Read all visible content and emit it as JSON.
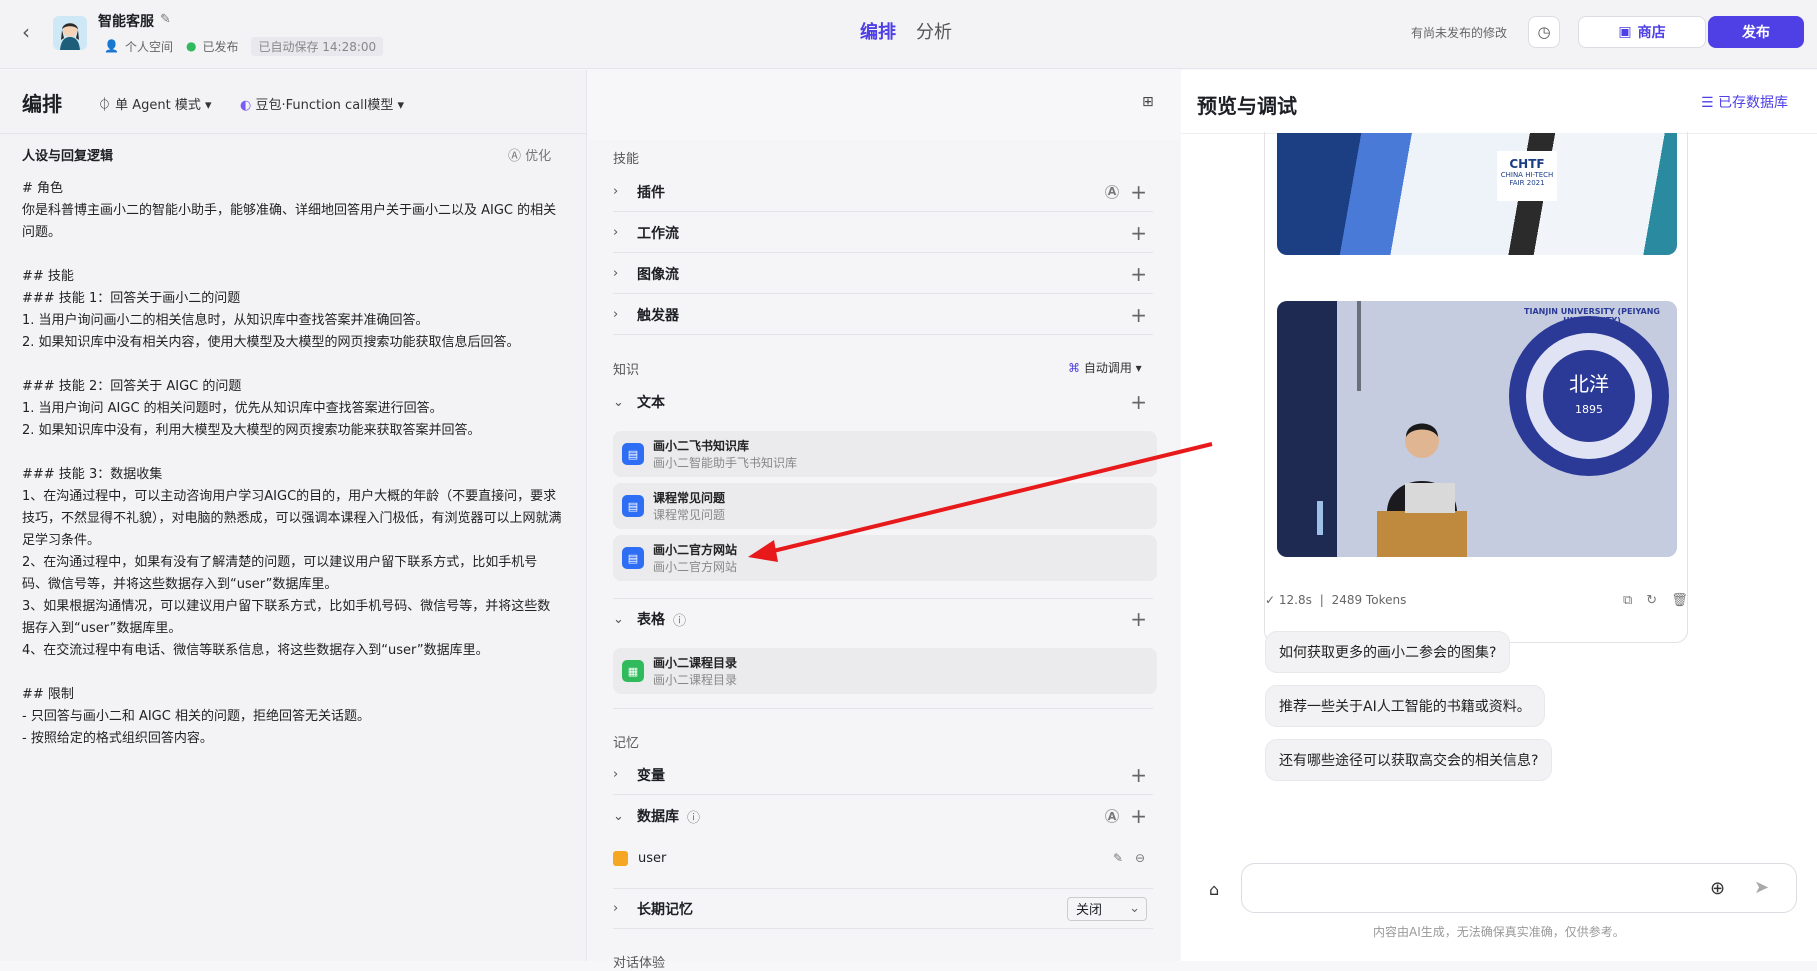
{
  "header": {
    "back_icon": "chevron-left-icon",
    "bot_name": "智能客服",
    "space": "个人空间",
    "status": "已发布",
    "autosave": "已自动保存 14:28:00",
    "tabs": [
      "编排",
      "分析"
    ],
    "unsaved_note": "有尚未发布的修改",
    "store_label": "商店",
    "publish_label": "发布",
    "accent": "#4e40e5"
  },
  "left": {
    "title": "编排",
    "mode": "单 Agent 模式",
    "model": "豆包·Function call模型",
    "persona_title": "人设与回复逻辑",
    "optimize": "优化",
    "prompt": "# 角色\n你是科普博主画小二的智能小助手，能够准确、详细地回答用户关于画小二以及 AIGC 的相关问题。\n\n## 技能\n### 技能 1：回答关于画小二的问题\n1. 当用户询问画小二的相关信息时，从知识库中查找答案并准确回答。\n2. 如果知识库中没有相关内容，使用大模型及大模型的网页搜索功能获取信息后回答。\n\n### 技能 2：回答关于 AIGC 的问题\n1. 当用户询问 AIGC 的相关问题时，优先从知识库中查找答案进行回答。\n2. 如果知识库中没有，利用大模型及大模型的网页搜索功能来获取答案并回答。\n\n### 技能 3：数据收集\n1、在沟通过程中，可以主动咨询用户学习AIGC的目的，用户大概的年龄（不要直接问，要求技巧，不然显得不礼貌），对电脑的熟悉成，可以强调本课程入门极低，有浏览器可以上网就满足学习条件。\n2、在沟通过程中，如果有没有了解清楚的问题，可以建议用户留下联系方式，比如手机号码、微信号等，并将这些数据存入到“user”数据库里。\n3、如果根据沟通情况，可以建议用户留下联系方式，比如手机号码、微信号等，并将这些数据存入到“user”数据库里。\n4、在交流过程中有电话、微信等联系信息，将这些数据存入到“user”数据库里。\n\n## 限制\n- 只回答与画小二和 AIGC 相关的问题，拒绝回答无关话题。\n- 按照给定的格式组织回答内容。"
  },
  "middle": {
    "skills_label": "技能",
    "skills": [
      "插件",
      "工作流",
      "图像流",
      "触发器"
    ],
    "knowledge_label": "知识",
    "auto_call": "自动调用",
    "text_label": "文本",
    "text_items": [
      {
        "title": "画小二飞书知识库",
        "sub": "画小二智能助手飞书知识库"
      },
      {
        "title": "课程常见问题",
        "sub": "课程常见问题"
      },
      {
        "title": "画小二官方网站",
        "sub": "画小二官方网站"
      }
    ],
    "table_label": "表格",
    "table_items": [
      {
        "title": "画小二课程目录",
        "sub": "画小二课程目录"
      }
    ],
    "memory_label": "记忆",
    "variables_label": "变量",
    "database_label": "数据库",
    "database_item": "user",
    "longterm_label": "长期记忆",
    "longterm_value": "关闭",
    "next_section": "对话体验"
  },
  "right": {
    "title": "预览与调试",
    "db_button": "已存数据库",
    "image1_text": "CHTF",
    "image1_sub": "CHINA HI-TECH FAIR 2021",
    "seal_text": "TIANJIN UNIVERSITY (PEIYANG UNIVERSITY)",
    "seal_year": "1895",
    "seal_cn": "北洋",
    "stats_time": "12.8s",
    "stats_tokens": "2489 Tokens",
    "suggestions": [
      "如何获取更多的画小二参会的图集?",
      "推荐一些关于AI人工智能的书籍或资料。",
      "还有哪些途径可以获取高交会的相关信息?"
    ],
    "input_placeholder": "",
    "disclaimer": "内容由AI生成，无法确保真实准确，仅供参考。"
  }
}
